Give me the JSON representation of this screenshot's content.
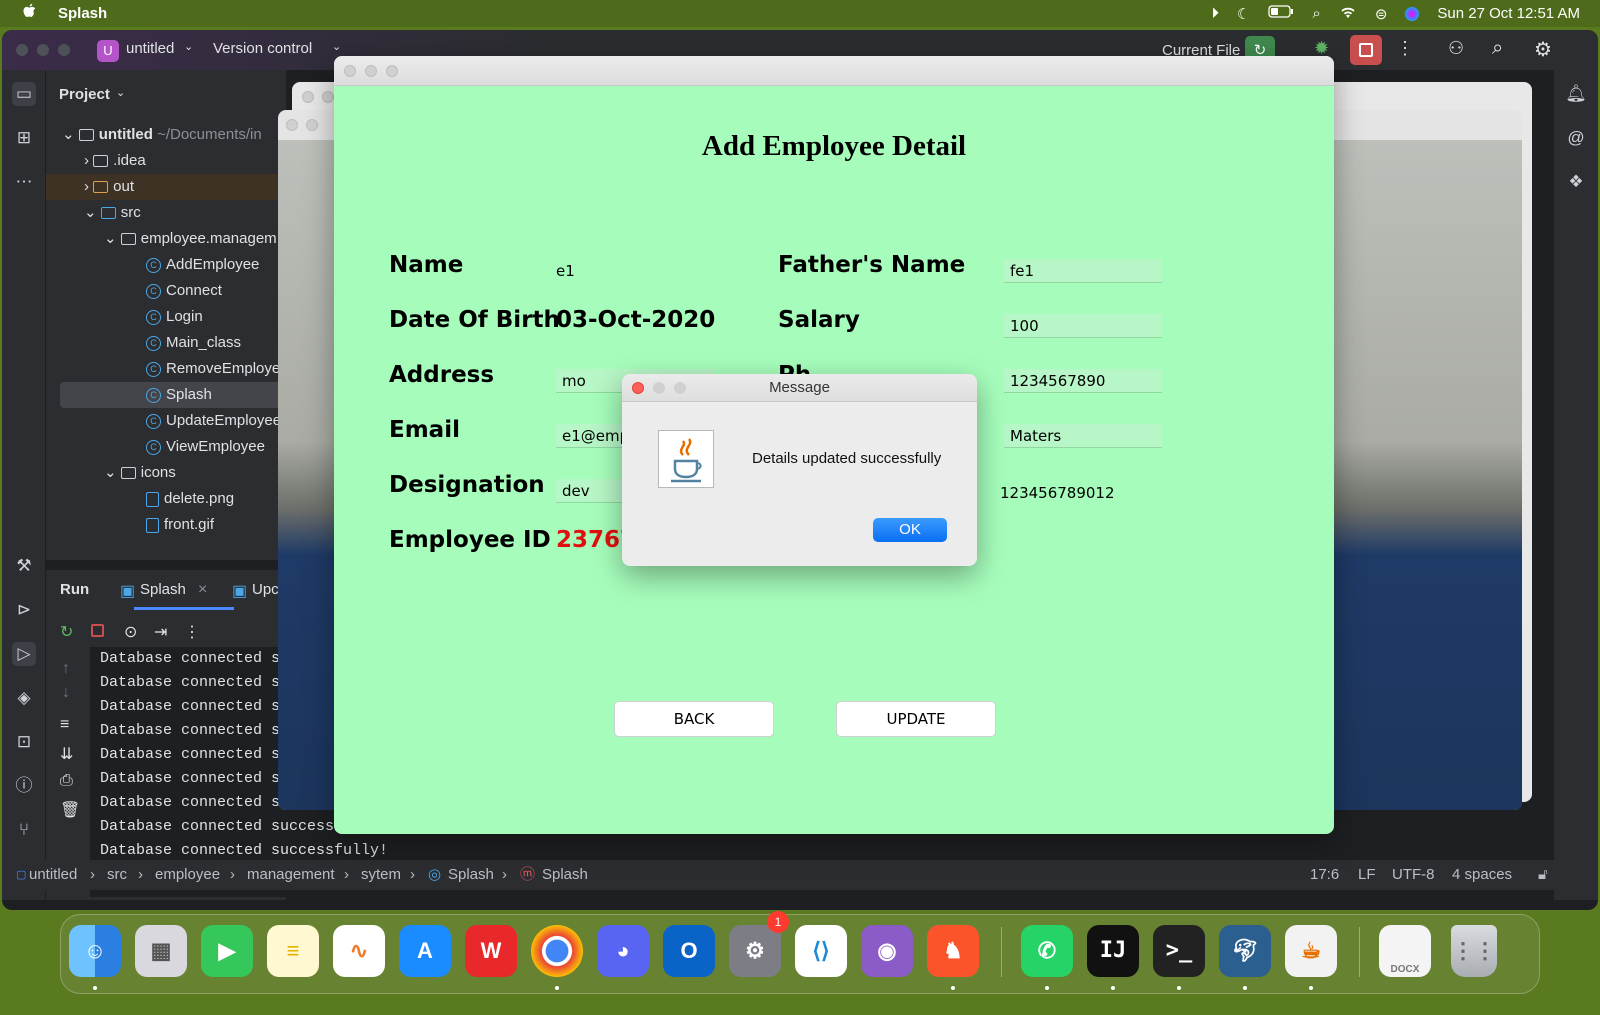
{
  "menubar": {
    "apple": "",
    "app_name": "Splash",
    "datetime": "Sun 27 Oct  12:51 AM"
  },
  "ide": {
    "project_badge": "U",
    "project_name": "untitled",
    "vcs": "Version control",
    "run_config": "Current File",
    "panel_title": "Project",
    "tree": [
      {
        "label": "untitled",
        "suffix": "~/Documents/in",
        "kind": "folder",
        "level": 0,
        "arrow": "v"
      },
      {
        "label": ".idea",
        "kind": "folder",
        "level": 1,
        "arrow": ">"
      },
      {
        "label": "out",
        "kind": "folder",
        "level": 1,
        "arrow": ">"
      },
      {
        "label": "src",
        "kind": "folder",
        "level": 1,
        "arrow": "v"
      },
      {
        "label": "employee.managem",
        "kind": "package",
        "level": 2,
        "arrow": "v"
      },
      {
        "label": "AddEmployee",
        "kind": "class",
        "level": 3
      },
      {
        "label": "Connect",
        "kind": "class",
        "level": 3
      },
      {
        "label": "Login",
        "kind": "class",
        "level": 3
      },
      {
        "label": "Main_class",
        "kind": "class",
        "level": 3
      },
      {
        "label": "RemoveEmploye",
        "kind": "class",
        "level": 3
      },
      {
        "label": "Splash",
        "kind": "class",
        "level": 3,
        "selected": true
      },
      {
        "label": "UpdateEmployee",
        "kind": "class",
        "level": 3
      },
      {
        "label": "ViewEmployee",
        "kind": "class",
        "level": 3
      },
      {
        "label": "icons",
        "kind": "package",
        "level": 2,
        "arrow": "v"
      },
      {
        "label": "delete.png",
        "kind": "file",
        "level": 3
      },
      {
        "label": "front.gif",
        "kind": "file",
        "level": 3
      }
    ],
    "run": {
      "title": "Run",
      "tab1": "Splash",
      "tab2": "Upc"
    },
    "console_lines": [
      "Database connected su",
      "Database connected su",
      "Database connected su",
      "Database connected su",
      "Database connected su",
      "Database connected su",
      "Database connected su",
      "Database connected successf",
      "Database connected successfully!"
    ],
    "breadcrumb": [
      "untitled",
      "src",
      "employee",
      "management",
      "sytem",
      "Splash",
      "Splash"
    ],
    "status": {
      "position": "17:6",
      "line_sep": "LF",
      "encoding": "UTF-8",
      "indent": "4 spaces"
    }
  },
  "form": {
    "title": "Add Employee Detail",
    "name_label": "Name",
    "name_value": "e1",
    "father_label": "Father's Name",
    "father_value": "fe1",
    "dob_label": "Date Of Birth",
    "dob_value": "03-Oct-2020",
    "salary_label": "Salary",
    "salary_value": "100",
    "address_label": "Address",
    "address_value": "mo",
    "phone_label": "Ph",
    "phone_value": "1234567890",
    "email_label": "Email",
    "email_value": "e1@emp.",
    "education_value": "Maters",
    "designation_label": "Designation",
    "designation_value": "dev",
    "aadhar_value": "123456789012",
    "empid_label": "Employee ID",
    "empid_value": "23767",
    "back_label": "BACK",
    "update_label": "UPDATE"
  },
  "dialog": {
    "title": "Message",
    "message": "Details updated successfully",
    "ok_label": "OK"
  },
  "dock": {
    "apps": [
      "finder",
      "launchpad",
      "facetime",
      "notes",
      "freeform",
      "app-store",
      "wps-office",
      "chrome",
      "discord",
      "outlook",
      "system-settings",
      "vscode",
      "github-desktop",
      "brave",
      "whatsapp",
      "intellij",
      "terminal",
      "mysql-workbench",
      "java",
      "document",
      "trash"
    ],
    "settings_badge": "1",
    "doc_label": "DOCX"
  },
  "colors": {
    "form_bg": "#a6fdbb",
    "empid_red": "#e01010",
    "ok_blue": "#0a6ff2"
  }
}
